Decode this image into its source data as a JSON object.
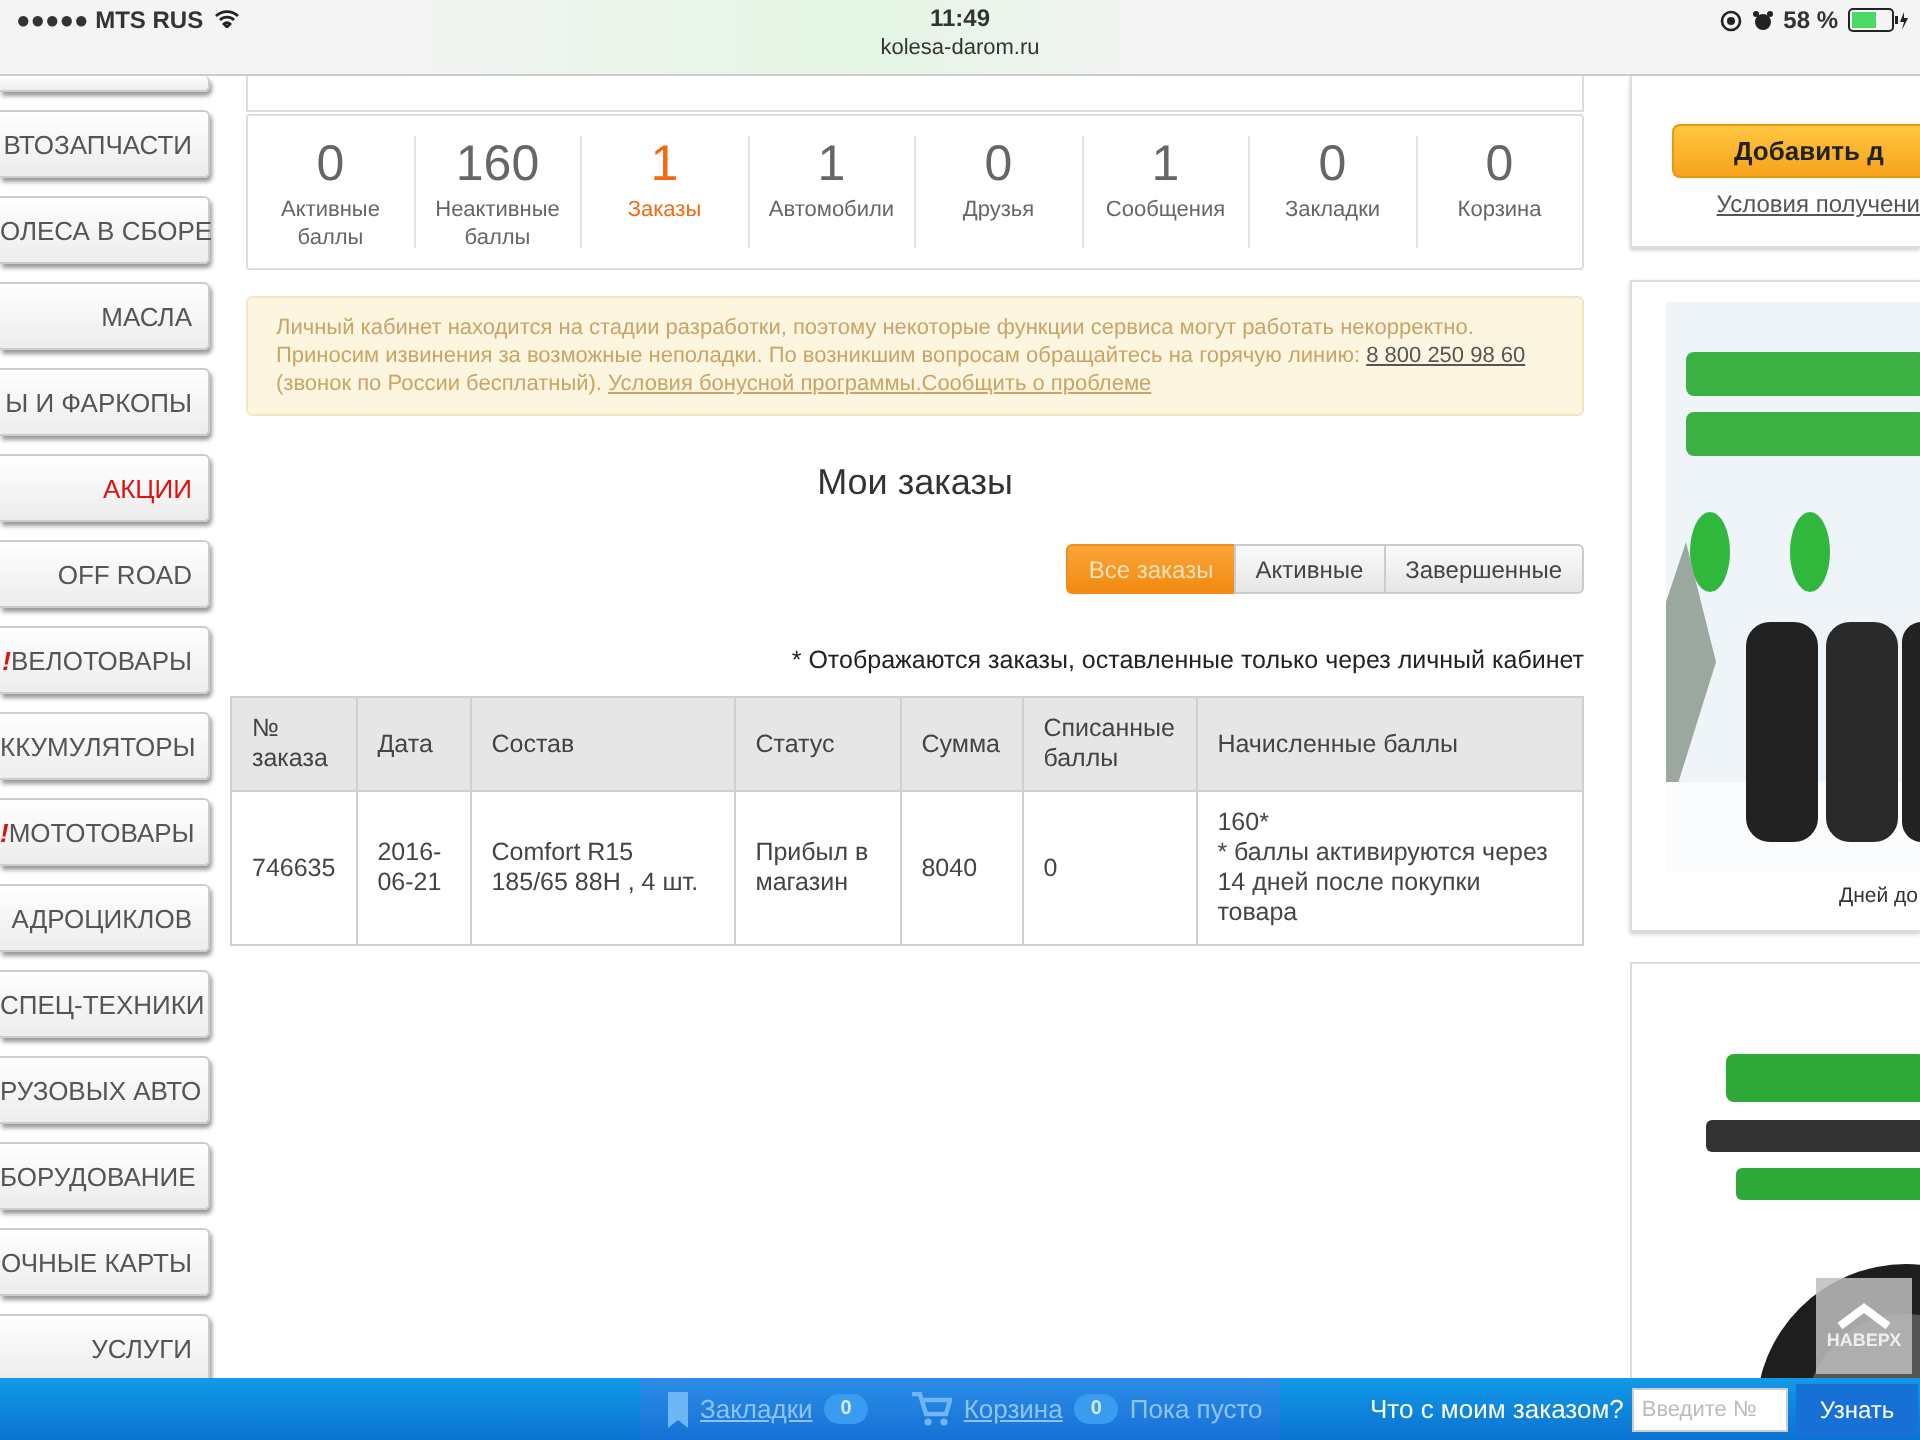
{
  "status_bar": {
    "carrier": "●●●●● MTS RUS",
    "time": "11:49",
    "url": "kolesa-darom.ru",
    "battery": "58 %"
  },
  "sidebar": {
    "items": [
      {
        "label": "ВТОЗАПЧАСТИ",
        "highlight": false
      },
      {
        "label": "ОЛЕСА В СБОРЕ",
        "highlight": false
      },
      {
        "label": "МАСЛА",
        "highlight": false
      },
      {
        "label": "Ы И ФАРКОПЫ",
        "highlight": false
      },
      {
        "label": "АКЦИИ",
        "highlight": true
      },
      {
        "label": "OFF ROAD",
        "highlight": false
      },
      {
        "label": "ВЕЛОТОВАРЫ",
        "highlight": false,
        "badge": "!"
      },
      {
        "label": "ККУМУЛЯТОРЫ",
        "highlight": false
      },
      {
        "label": "МОТОТОВАРЫ",
        "highlight": false,
        "badge": "!"
      },
      {
        "label": "АДРОЦИКЛОВ",
        "highlight": false
      },
      {
        "label": "СПЕЦ-ТЕХНИКИ",
        "highlight": false
      },
      {
        "label": "РУЗОВЫХ АВТО",
        "highlight": false
      },
      {
        "label": "БОРУДОВАНИЕ",
        "highlight": false
      },
      {
        "label": "ОЧНЫЕ КАРТЫ",
        "highlight": false
      },
      {
        "label": "УСЛУГИ",
        "highlight": false
      }
    ]
  },
  "stats": [
    {
      "value": "0",
      "label": "Активные баллы",
      "selected": false
    },
    {
      "value": "160",
      "label": "Неактивные баллы",
      "selected": false
    },
    {
      "value": "1",
      "label": "Заказы",
      "selected": true
    },
    {
      "value": "1",
      "label": "Автомобили",
      "selected": false
    },
    {
      "value": "0",
      "label": "Друзья",
      "selected": false
    },
    {
      "value": "1",
      "label": "Сообщения",
      "selected": false
    },
    {
      "value": "0",
      "label": "Закладки",
      "selected": false
    },
    {
      "value": "0",
      "label": "Корзина",
      "selected": false
    }
  ],
  "notice": {
    "text": "Личный кабинет находится на стадии разработки, поэтому некоторые функции сервиса могут работать некорректно. Приносим извинения за возможные неполадки. По возникшим вопросам обращайтесь на горячую линию:",
    "phone": "8 800 250 98 60",
    "after": "(звонок по России бесплатный).",
    "links": [
      "Условия бонусной программы.",
      "Сообщить о проблеме"
    ]
  },
  "heading": "Мои заказы",
  "filters": [
    {
      "label": "Все заказы",
      "selected": true
    },
    {
      "label": "Активные",
      "selected": false
    },
    {
      "label": "Завершенные",
      "selected": false
    }
  ],
  "footnote": "* Отображаются заказы, оставленные только через личный кабинет",
  "table": {
    "columns": [
      "№ заказа",
      "Дата",
      "Состав",
      "Статус",
      "Сумма",
      "Списанные баллы",
      "Начисленные баллы"
    ],
    "rows": [
      [
        "746635",
        "2016-06-21",
        "Comfort R15 185/65 88H , 4 шт.",
        "Прибыл в магазин",
        "8040",
        "0",
        "160*\n* баллы активируются через 14 дней после покупки товара"
      ]
    ]
  },
  "right": {
    "button": "Добавить д",
    "link": "Условия получени",
    "banner_caption": "Дней до",
    "scroll_top": "НАВЕРХ"
  },
  "bottom_bar": {
    "bookmarks": "Закладки",
    "bookmarks_count": "0",
    "cart": "Корзина",
    "cart_count": "0",
    "cart_status": "Пока пусто",
    "order_question": "Что с моим заказом?",
    "order_placeholder": "Введите №",
    "order_button": "Узнать"
  }
}
